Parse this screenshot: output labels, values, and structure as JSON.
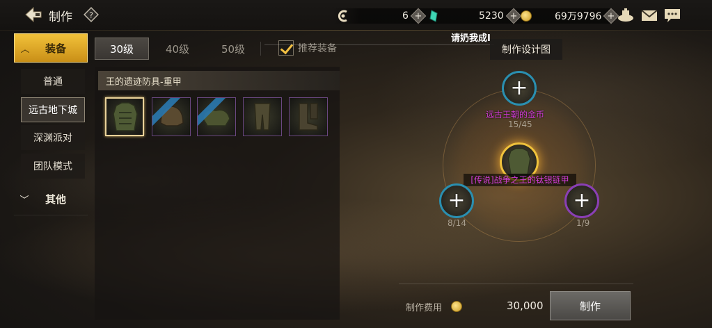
{
  "header": {
    "title": "制作",
    "help_icon": "?",
    "resources": [
      {
        "icon": "crystal-icon",
        "value": "6"
      },
      {
        "icon": "gem-icon",
        "value": "5230"
      },
      {
        "icon": "coin-icon",
        "value": "69万9796"
      }
    ],
    "icons": [
      "airship-icon",
      "mail-icon",
      "chat-icon"
    ]
  },
  "sidebar": {
    "category_active": {
      "label": "装备",
      "icon": "chevron-up-icon"
    },
    "items": [
      {
        "label": "普通"
      },
      {
        "label": "远古地下城"
      },
      {
        "label": "深渊派对"
      },
      {
        "label": "团队模式"
      }
    ],
    "category_other": {
      "label": "其他",
      "icon": "chevron-down-icon"
    }
  },
  "level_tabs": [
    "30级",
    "40级",
    "50级"
  ],
  "recommend": {
    "label": "推荐装备",
    "checked": true
  },
  "notice": "请奶我成I",
  "set": {
    "name": "王的遗迹防具-重甲"
  },
  "item_slots": 5,
  "blueprint": {
    "tag": "制作设计图",
    "top_material": {
      "name": "远古王朝的金币",
      "count": "15/45"
    },
    "center_item": {
      "name": "[传说]战争之王的钛银链甲"
    },
    "left_material": {
      "count": "8/14"
    },
    "right_material": {
      "count": "1/9"
    }
  },
  "cost": {
    "label": "制作费用",
    "value": "30,000"
  },
  "craft_button": "制作",
  "colors": {
    "accent_gold": "#f2c23a",
    "legendary": "#d23cd8",
    "rare_blue": "#2a8fb0",
    "epic_purple": "#8a3fb5"
  }
}
